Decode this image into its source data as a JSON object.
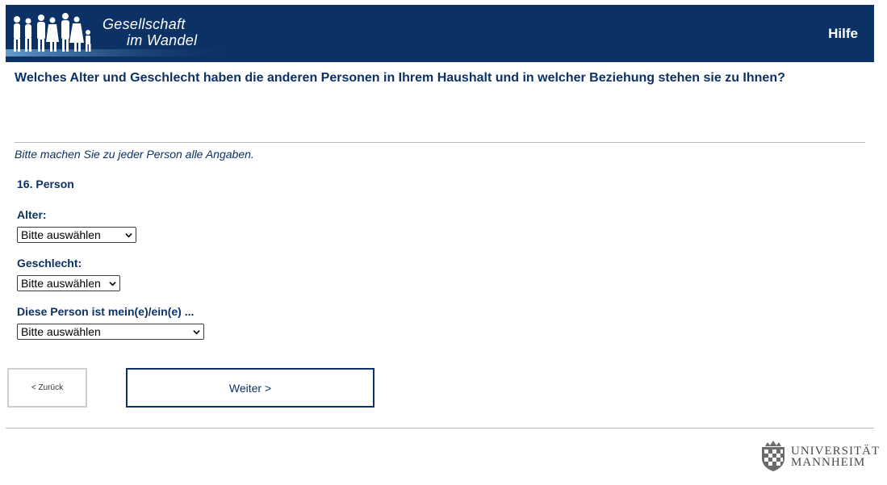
{
  "header": {
    "logo_line1": "Gesellschaft",
    "logo_line2": "im Wandel",
    "help_link": "Hilfe"
  },
  "question": "Welches Alter und Geschlecht haben die anderen Personen in Ihrem Haushalt und in welcher Beziehung stehen sie zu Ihnen?",
  "instruction": "Bitte machen Sie zu jeder Person alle Angaben.",
  "person_title": "16. Person",
  "fields": [
    {
      "label": "Alter:",
      "selected": "Bitte auswählen"
    },
    {
      "label": "Geschlecht:",
      "selected": "Bitte auswählen"
    },
    {
      "label": "Diese Person ist mein(e)/ein(e) ...",
      "selected": "Bitte auswählen"
    }
  ],
  "buttons": {
    "back": "< Zurück",
    "next": "Weiter >"
  },
  "footer": {
    "uni_line1": "UNIVERSITÄT",
    "uni_line2": "MANNHEIM"
  },
  "colors": {
    "brand_navy": "#0c3265",
    "divider_gray": "#b8b8b8"
  }
}
